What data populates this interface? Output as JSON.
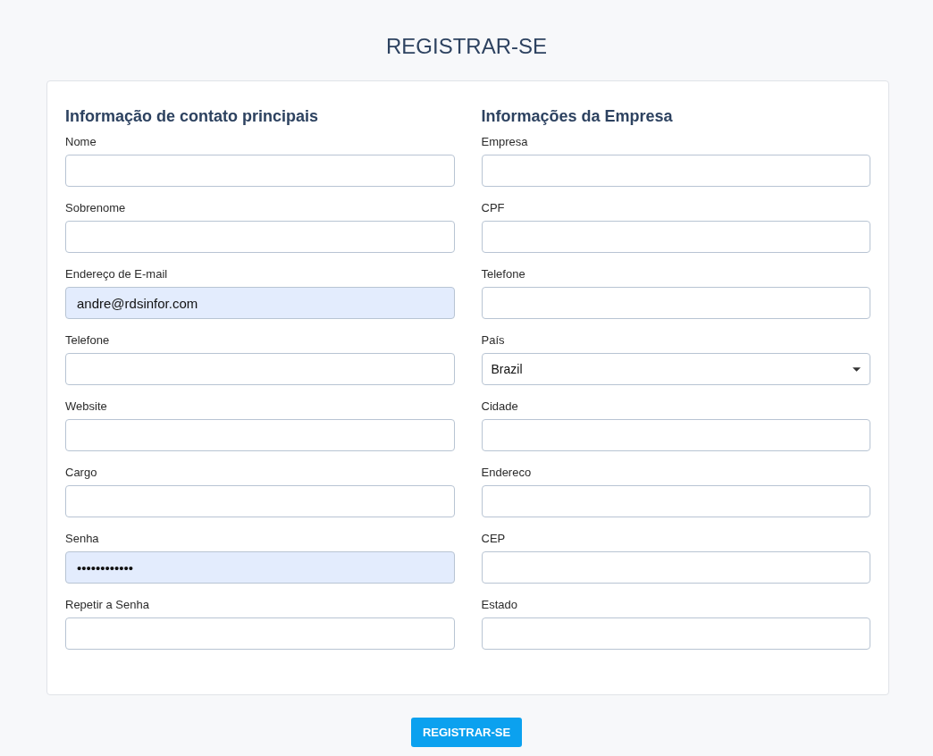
{
  "title": "REGISTRAR-SE",
  "sections": [
    {
      "heading": "Informação de contato principais",
      "fields": [
        {
          "kind": "text",
          "label": "Nome",
          "autofilled": false
        },
        {
          "kind": "text",
          "label": "Sobrenome",
          "autofilled": false
        },
        {
          "kind": "text",
          "label": "Endereço de E-mail",
          "value": "andre@rdsinfor.com",
          "autofilled": true
        },
        {
          "kind": "text",
          "label": "Telefone",
          "autofilled": false
        },
        {
          "kind": "text",
          "label": "Website",
          "autofilled": false
        },
        {
          "kind": "text",
          "label": "Cargo",
          "autofilled": false
        },
        {
          "kind": "text",
          "label": "Senha",
          "value": "••••••••••••",
          "autofilled": true
        },
        {
          "kind": "text",
          "label": "Repetir a Senha",
          "autofilled": false
        }
      ]
    },
    {
      "heading": "Informações da Empresa",
      "fields": [
        {
          "kind": "text",
          "label": "Empresa",
          "autofilled": false
        },
        {
          "kind": "text",
          "label": "CPF",
          "autofilled": false
        },
        {
          "kind": "text",
          "label": "Telefone",
          "autofilled": false
        },
        {
          "kind": "select",
          "label": "País",
          "value": "Brazil",
          "autofilled": false
        },
        {
          "kind": "text",
          "label": "Cidade",
          "autofilled": false
        },
        {
          "kind": "text",
          "label": "Endereco",
          "autofilled": false
        },
        {
          "kind": "text",
          "label": "CEP",
          "autofilled": false
        },
        {
          "kind": "text",
          "label": "Estado",
          "autofilled": false
        }
      ]
    }
  ],
  "submit": "REGISTRAR-SE"
}
